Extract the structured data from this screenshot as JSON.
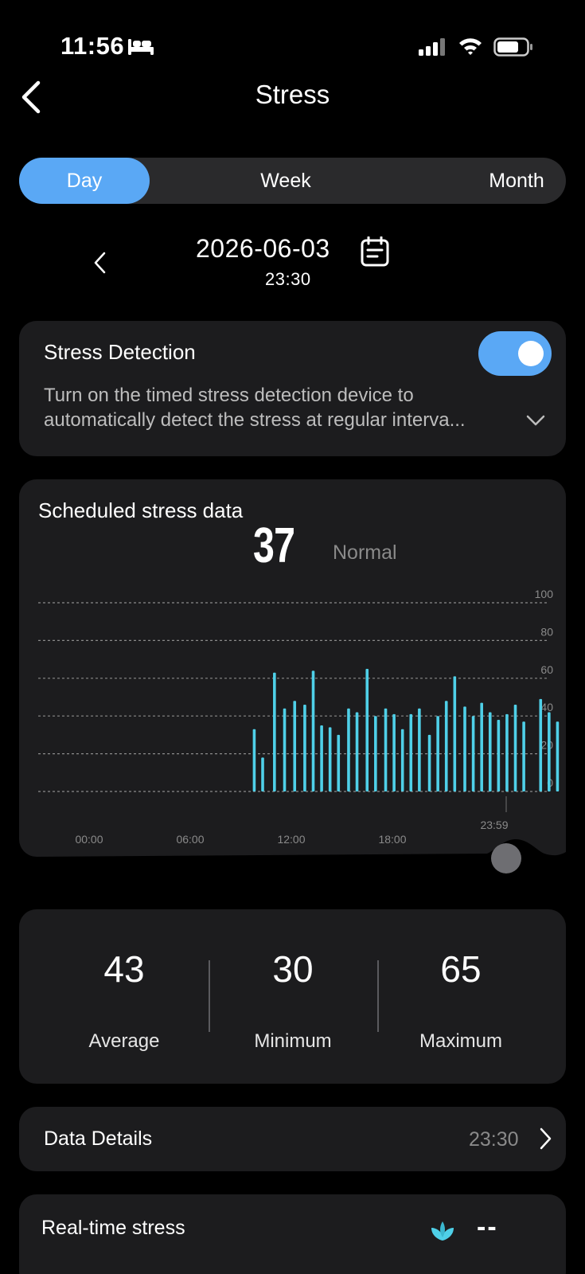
{
  "status_bar": {
    "time": "11:56",
    "icons": [
      "bed-icon",
      "signal-icon",
      "wifi-icon",
      "battery-icon"
    ]
  },
  "header": {
    "title": "Stress",
    "back_icon": "chevron-left-icon"
  },
  "tabs": [
    {
      "label": "Day",
      "selected": true
    },
    {
      "label": "Week",
      "selected": false
    },
    {
      "label": "Month",
      "selected": false
    }
  ],
  "date_nav": {
    "date": "2026-06-03",
    "time": "23:30"
  },
  "stress_detection": {
    "title": "Stress Detection",
    "enabled": true,
    "description": "Turn on the timed stress detection device to automatically detect the stress at regular interva..."
  },
  "scheduled_chart": {
    "title": "Scheduled stress data",
    "current_value": "37",
    "current_status": "Normal"
  },
  "chart_data": {
    "type": "bar",
    "y_ticks": [
      "100",
      "80",
      "60",
      "40",
      "20",
      "0"
    ],
    "x_ticks": [
      "00:00",
      "06:00",
      "12:00",
      "18:00"
    ],
    "cursor_label": "23:59",
    "ylim": [
      0,
      100
    ],
    "grid": true,
    "x_hours": [
      9.8,
      10.3,
      11.0,
      11.6,
      12.2,
      12.8,
      13.3,
      13.8,
      14.3,
      14.8,
      15.4,
      15.9,
      16.5,
      17.0,
      17.6,
      18.1,
      18.6,
      19.1,
      19.6,
      20.2,
      20.7,
      21.2,
      21.7,
      22.3,
      22.8,
      23.3,
      23.8,
      24.3,
      24.8,
      25.3,
      25.8,
      26.8,
      27.3,
      27.8
    ],
    "values": [
      33,
      18,
      63,
      44,
      48,
      46,
      64,
      35,
      34,
      30,
      44,
      42,
      65,
      40,
      44,
      41,
      33,
      41,
      44,
      30,
      40,
      48,
      61,
      45,
      40,
      47,
      42,
      38,
      41,
      46,
      37,
      49,
      42,
      37
    ],
    "bar_color": "#4fd0e8",
    "cursor_color": "#4fd05a"
  },
  "summary": {
    "average": {
      "value": "43",
      "label": "Average"
    },
    "minimum": {
      "value": "30",
      "label": "Minimum"
    },
    "maximum": {
      "value": "65",
      "label": "Maximum"
    }
  },
  "data_details": {
    "label": "Data Details",
    "value": "23:30"
  },
  "realtime": {
    "label": "Real-time stress",
    "value": "--",
    "icon": "leaf-icon",
    "icon_color": "#4fd0e8"
  },
  "colors": {
    "accent": "#5aa8f5",
    "card": "#1c1c1e",
    "bar": "#4fd0e8"
  }
}
